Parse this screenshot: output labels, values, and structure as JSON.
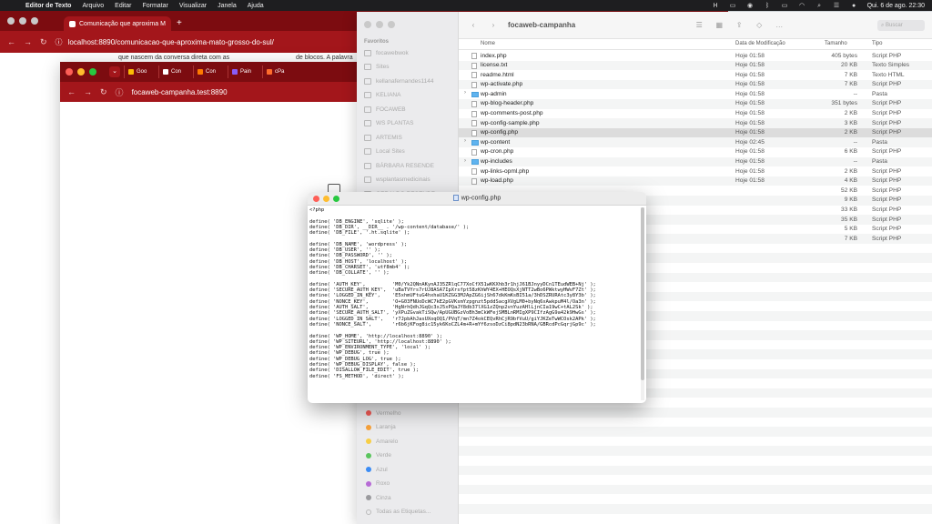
{
  "menubar": {
    "app_name": "Editor de Texto",
    "items": [
      "Arquivo",
      "Editar",
      "Formatar",
      "Visualizar",
      "Janela",
      "Ajuda"
    ],
    "datetime": "Qui. 6 de ago.  22:30"
  },
  "browser1": {
    "tab_title": "Comunicação que aproxima M",
    "new_tab": "+",
    "url": "localhost:8890/comunicacao-que-aproxima-mato-grosso-do-sul/",
    "snippet1": "que nascem da conversa direta com as",
    "snippet2": "de blocos. A palavra"
  },
  "browser2": {
    "tabs": [
      "Goo",
      "Con",
      "Con",
      "Pain",
      "cPa"
    ],
    "url": "focaweb-campanha.test:8890"
  },
  "finder": {
    "title": "focaweb-campanha",
    "search_placeholder": "Buscar",
    "favorites_header": "Favoritos",
    "sidebar_items": [
      "focawebwok",
      "Sites",
      "kellanafernandes1144",
      "KELIANA",
      "FOCAWEB",
      "WS PLANTAS",
      "ARTEMIS",
      "Local Sites",
      "BÁRBARA RESENDE",
      "wsplantasmedicinais",
      "GERALDO RESENDE"
    ],
    "tags": [
      {
        "label": "Vermelho",
        "color": "#f25a55"
      },
      {
        "label": "Laranja",
        "color": "#f7a23b"
      },
      {
        "label": "Amarelo",
        "color": "#f7ce46"
      },
      {
        "label": "Verde",
        "color": "#5ac55e"
      },
      {
        "label": "Azul",
        "color": "#3b8cf5"
      },
      {
        "label": "Roxo",
        "color": "#b76bd6"
      },
      {
        "label": "Cinza",
        "color": "#9a9a9e"
      },
      {
        "label": "Todas as Etiquetas...",
        "color": ""
      }
    ],
    "columns": {
      "name": "Nome",
      "date": "Data de Modificação",
      "size": "Tamanho",
      "kind": "Tipo"
    },
    "files": [
      {
        "name": "index.php",
        "date": "Hoje 01:58",
        "size": "405 bytes",
        "kind": "Script PHP",
        "folder": false
      },
      {
        "name": "license.txt",
        "date": "Hoje 01:58",
        "size": "20 KB",
        "kind": "Texto Simples",
        "folder": false
      },
      {
        "name": "readme.html",
        "date": "Hoje 01:58",
        "size": "7 KB",
        "kind": "Texto HTML",
        "folder": false
      },
      {
        "name": "wp-activate.php",
        "date": "Hoje 01:58",
        "size": "7 KB",
        "kind": "Script PHP",
        "folder": false
      },
      {
        "name": "wp-admin",
        "date": "Hoje 01:58",
        "size": "--",
        "kind": "Pasta",
        "folder": true
      },
      {
        "name": "wp-blog-header.php",
        "date": "Hoje 01:58",
        "size": "351 bytes",
        "kind": "Script PHP",
        "folder": false
      },
      {
        "name": "wp-comments-post.php",
        "date": "Hoje 01:58",
        "size": "2 KB",
        "kind": "Script PHP",
        "folder": false
      },
      {
        "name": "wp-config-sample.php",
        "date": "Hoje 01:58",
        "size": "3 KB",
        "kind": "Script PHP",
        "folder": false
      },
      {
        "name": "wp-config.php",
        "date": "Hoje 01:58",
        "size": "2 KB",
        "kind": "Script PHP",
        "folder": false,
        "selected": true
      },
      {
        "name": "wp-content",
        "date": "Hoje 02:45",
        "size": "--",
        "kind": "Pasta",
        "folder": true
      },
      {
        "name": "wp-cron.php",
        "date": "Hoje 01:58",
        "size": "6 KB",
        "kind": "Script PHP",
        "folder": false
      },
      {
        "name": "wp-includes",
        "date": "Hoje 01:58",
        "size": "--",
        "kind": "Pasta",
        "folder": true
      },
      {
        "name": "wp-links-opml.php",
        "date": "Hoje 01:58",
        "size": "2 KB",
        "kind": "Script PHP",
        "folder": false
      },
      {
        "name": "wp-load.php",
        "date": "Hoje 01:58",
        "size": "4 KB",
        "kind": "Script PHP",
        "folder": false
      },
      {
        "name": "",
        "date": "",
        "size": "52 KB",
        "kind": "Script PHP",
        "folder": false
      },
      {
        "name": "",
        "date": "",
        "size": "9 KB",
        "kind": "Script PHP",
        "folder": false
      },
      {
        "name": "",
        "date": "",
        "size": "33 KB",
        "kind": "Script PHP",
        "folder": false
      },
      {
        "name": "",
        "date": "",
        "size": "35 KB",
        "kind": "Script PHP",
        "folder": false
      },
      {
        "name": "",
        "date": "",
        "size": "5 KB",
        "kind": "Script PHP",
        "folder": false
      },
      {
        "name": "",
        "date": "",
        "size": "7 KB",
        "kind": "Script PHP",
        "folder": false
      }
    ]
  },
  "editor": {
    "title": "wp-config.php",
    "lines": [
      "<?php",
      "",
      "define( 'DB_ENGINE', 'sqlite' );",
      "define( 'DB_DIR', __DIR__ . '/wp-content/database/' );",
      "define( 'DB_FILE', '.ht.sqlite' );",
      "",
      "define( 'DB_NAME', 'wordpress' );",
      "define( 'DB_USER', '' );",
      "define( 'DB_PASSWORD', '' );",
      "define( 'DB_HOST', 'localhost' );",
      "define( 'DB_CHARSET', 'utf8mb4' );",
      "define( 'DB_COLLATE', '' );",
      "",
      "define( 'AUTH_KEY',         'M0/Yk2QNnAKynAJ35ZRlqC77XoCfX51wKKXhb3r1hjJ61BJnyyDCn1TEudWEB+Nj' );",
      "define( 'SECURE_AUTH_KEY',  'uBaTVYrs7rUJ8ASA7IpXrsfpt58zKhWY4EX+HEOQsXjNTT2wBo6PWktwyHWvF7Zt' );",
      "define( 'LOGGED_IN_KEY',    'E5xhmUFtuG4hxhaU1KZGG3MJApZG6ijSh67dkKmKsBI51a/3hDSZRURAtc3y8Y3b' );",
      "define( 'NONCE_KEY',        'O+G03FNUoDcWC7kE2pGVKsmYzpgnzt5pddSacgXVgLM0+byNq6xAwkpuM4l/Oa3n' );",
      "define( 'AUTH_SALT',        'HgNrhQdhJGqQc3xJ5xPQaJY8db37lXG1zZQnp2vnYuzAHlLjnCIa19wC+tAL2Sk' );",
      "define( 'SECURE_AUTH_SALT', 'yXPuZGvakTiSQw/ApUGUBGzVoBh3mCkWFejSMBLnRMIgXP9CIfzAgG9a42k9HwGs' );",
      "define( 'LOGGED_IN_SALT',   'r7JpbAhJasUXoqOQ1/PVqT/mn7Z4okCEQvRhCjR9bfVuU/giYJKZeTwWCOsk2APk' );",
      "define( 'NONCE_SALT',       'r6b6jKFog8ic15yk6KoCZL4m+R+mYf6zsoDzCi8pdN23bRNA/GBRcdPcGqrjGp9c' );",
      "",
      "define( 'WP_HOME', 'http://localhost:8890' );",
      "define( 'WP_SITEURL', 'http://localhost:8890' );",
      "define( 'WP_ENVIRONMENT_TYPE', 'local' );",
      "define( 'WP_DEBUG', true );",
      "define( 'WP_DEBUG_LOG', true );",
      "define( 'WP_DEBUG_DISPLAY', false );",
      "define( 'DISALLOW_FILE_EDIT', true );",
      "define( 'FS_METHOD', 'direct' );"
    ]
  }
}
